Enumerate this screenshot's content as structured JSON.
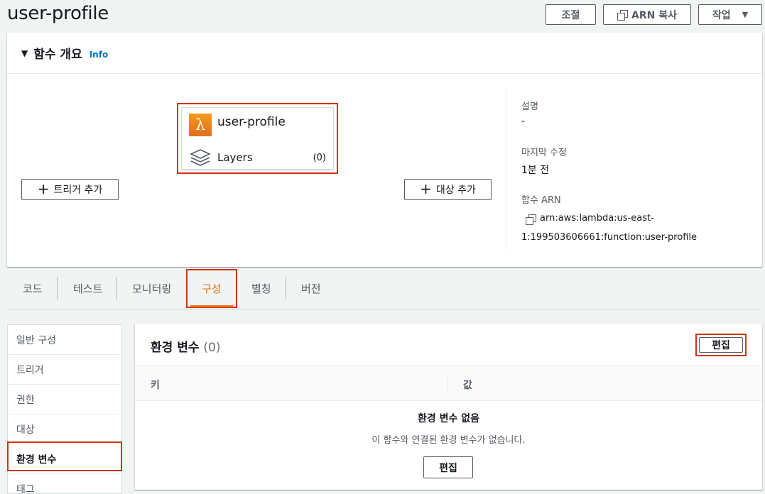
{
  "header": {
    "title": "user-profile",
    "adjust_label": "조절",
    "copy_arn_label": "ARN 복사",
    "actions_label": "작업"
  },
  "overview": {
    "title": "함수 개요",
    "info_label": "Info",
    "function_name": "user-profile",
    "layers_label": "Layers",
    "layers_count": "(0)",
    "add_trigger_label": "트리거 추가",
    "add_destination_label": "대상 추가",
    "description_label": "설명",
    "description_value": "-",
    "last_modified_label": "마지막 수정",
    "last_modified_value": "1분 전",
    "arn_label": "함수 ARN",
    "arn_value_line1": "arn:aws:lambda:us-east-",
    "arn_value_line2": "1:199503606661:function:user-profile"
  },
  "tabs": [
    {
      "label": "코드"
    },
    {
      "label": "테스트"
    },
    {
      "label": "모니터링"
    },
    {
      "label": "구성"
    },
    {
      "label": "별칭"
    },
    {
      "label": "버전"
    }
  ],
  "active_tab": "구성",
  "sidenav": {
    "items": [
      {
        "label": "일반 구성"
      },
      {
        "label": "트리거"
      },
      {
        "label": "권한"
      },
      {
        "label": "대상"
      },
      {
        "label": "환경 변수"
      },
      {
        "label": "태그"
      }
    ],
    "active": "환경 변수"
  },
  "env": {
    "title": "환경 변수",
    "count": "(0)",
    "edit_label": "편집",
    "col_key": "키",
    "col_value": "값",
    "empty_title": "환경 변수 없음",
    "empty_desc": "이 함수와 연결된 환경 변수가 없습니다.",
    "empty_edit_label": "편집"
  },
  "colors": {
    "highlight": "#d13212",
    "active_tab": "#ec7211",
    "link": "#0073bb",
    "lambda_orange": "#f7981f"
  }
}
